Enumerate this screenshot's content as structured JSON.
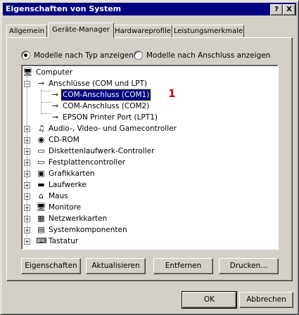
{
  "window": {
    "title": "Eigenschaften von System"
  },
  "titlebar_buttons": {
    "help": "?",
    "close": "X"
  },
  "tabs": [
    "Allgemein",
    "Geräte-Manager",
    "Hardwareprofile",
    "Leistungsmerkmale"
  ],
  "active_tab": "Geräte-Manager",
  "view_options": {
    "by_type": "Modelle nach Typ anzeigen",
    "by_connection": "Modelle nach Anschluss anzeigen",
    "selected": "by_type"
  },
  "tree": {
    "root": "Computer",
    "expanded": {
      "label": "Anschlüsse (COM und LPT)",
      "children": [
        "COM-Anschluss (COM1)",
        "COM-Anschluss (COM2)",
        "EPSON Printer Port (LPT1)"
      ],
      "selected": "COM-Anschluss (COM1)"
    },
    "collapsed": [
      "Audio-, Video- und Gamecontroller",
      "CD-ROM",
      "Diskettenlaufwerk-Controller",
      "Festplattencontroller",
      "Grafikkarten",
      "Laufwerke",
      "Maus",
      "Monitore",
      "Netzwerkkarten",
      "Systemkomponenten",
      "Tastatur"
    ]
  },
  "annotation": "1",
  "actions": {
    "properties": "Eigenschaften",
    "refresh": "Aktualisieren",
    "remove": "Entfernen",
    "print": "Drucken..."
  },
  "dialog_buttons": {
    "ok": "OK",
    "cancel": "Abbrechen"
  }
}
